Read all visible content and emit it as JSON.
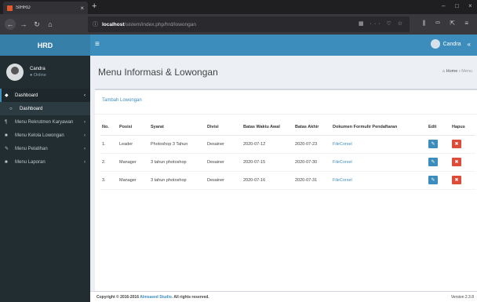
{
  "browser": {
    "tab_title": "SIHRD",
    "tab_close": "×",
    "new_tab": "+",
    "url_host": "localhost",
    "url_path": "/sistem/index.php/hrd/lowongan",
    "url_actions": "▦ ··· ♡ ☆",
    "nav_actions": "⫼ ▭ ⇱ ≡",
    "win_min": "–",
    "win_max": "□",
    "win_close": "×"
  },
  "app": {
    "logo": "HRD",
    "hamburger": "≡",
    "user_name": "Candra"
  },
  "sidebar": {
    "user_name": "Candra",
    "user_status": "● Online",
    "items": [
      {
        "icon": "◆",
        "label": "Dashboard",
        "caret": "‹"
      },
      {
        "icon": "○",
        "label": "Dashboard"
      },
      {
        "icon": "¶",
        "label": "Menu Rekrutmen Karyawan",
        "caret": "‹"
      },
      {
        "icon": "■",
        "label": "Menu Kelola Lowongan",
        "caret": "‹"
      },
      {
        "icon": "✎",
        "label": "Menu Pelatihan",
        "caret": "‹"
      },
      {
        "icon": "■",
        "label": "Menu Laporan",
        "caret": "‹"
      }
    ]
  },
  "content": {
    "title": "Menu Informasi & Lowongan",
    "breadcrumb_home": "Home",
    "breadcrumb_current": "Menu",
    "box_title": "Tambah Lowongan"
  },
  "table": {
    "headers": [
      "No.",
      "Posisi",
      "Syarat",
      "Divisi",
      "Batas Waktu Awal",
      "Batas Akhir",
      "Dokumen Formulir Pendaftaran",
      "Edit",
      "Hapus"
    ],
    "rows": [
      {
        "no": "1.",
        "posisi": "Leader",
        "syarat": "Photoshop 3 Tahun",
        "divisi": "Desainer",
        "awal": "2020-07-12",
        "akhir": "2020-07-23",
        "dokumen": "FileCorsel"
      },
      {
        "no": "2.",
        "posisi": "Manager",
        "syarat": "3 tahun photoshop",
        "divisi": "Desainer",
        "awal": "2020-07-15",
        "akhir": "2020-07-30",
        "dokumen": "FileCorsel"
      },
      {
        "no": "3.",
        "posisi": "Manager",
        "syarat": "3 tahun photoshop",
        "divisi": "Desainer",
        "awal": "2020-07-16",
        "akhir": "2020-07-31",
        "dokumen": "FileCorsel"
      }
    ],
    "edit_icon": "✎",
    "delete_icon": "✖"
  },
  "footer": {
    "copyright": "Copyright © 2016-2016",
    "brand": "Almsaeed Studio.",
    "rights": "All rights reserved.",
    "version": "Version 2.3.8"
  },
  "colors": {
    "primary": "#3c8dbc",
    "danger": "#dd4b39",
    "sidebar": "#222d32"
  }
}
